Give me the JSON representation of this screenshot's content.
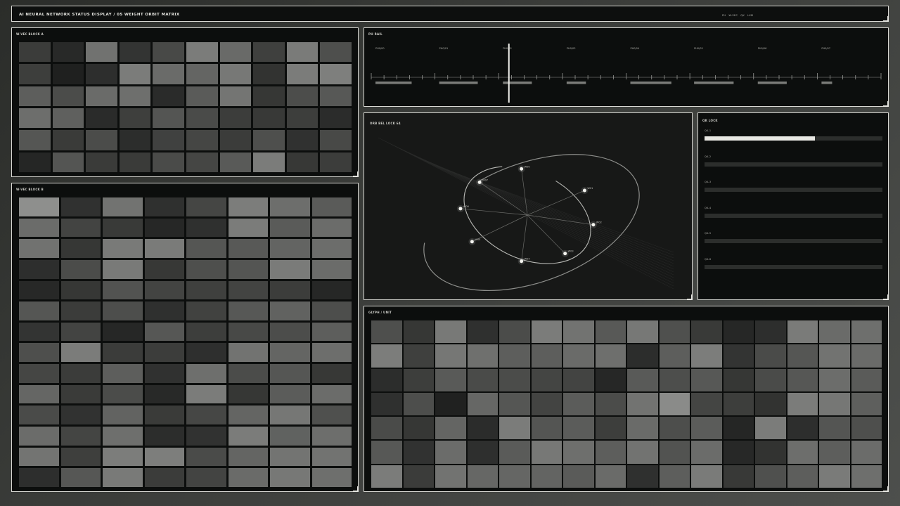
{
  "header": {
    "title": "AI NEURAL NETWORK STATUS DISPLAY  /  05  WEIGHT ORBIT MATRIX",
    "tags": [
      "PH",
      "W-VEC",
      "QK",
      "LUM"
    ]
  },
  "wvec_a": {
    "title": "W-VEC BLOCK A",
    "cols": 10,
    "cells": [
      "#3b3c3a",
      "#282928",
      "#717270",
      "#333433",
      "#484947",
      "#7b7c7a",
      "#696a68",
      "#3f403e",
      "#7a7b79",
      "#4e4f4d",
      "#3d3e3c",
      "#1f201f",
      "#2d2e2d",
      "#7b7c7a",
      "#6a6b69",
      "#646563",
      "#777876",
      "#323331",
      "#7b7c7a",
      "#7e7f7d",
      "#5d5e5c",
      "#4b4c4a",
      "#6a6b69",
      "#6e6f6d",
      "#2a2b2a",
      "#5a5b59",
      "#747573",
      "#363735",
      "#4c4d4b",
      "#575856",
      "#6d6e6c",
      "#5f605e",
      "#2a2b2a",
      "#3e3f3d",
      "#545553",
      "#4a4b49",
      "#3c3d3b",
      "#383937",
      "#3d3e3c",
      "#2b2c2b",
      "#555654",
      "#3a3b39",
      "#4b4c4a",
      "#2c2d2c",
      "#404140",
      "#454644",
      "#3b3c3a",
      "#4e4f4d",
      "#303130",
      "#484947",
      "#252625",
      "#545553",
      "#3a3b39",
      "#3a3b39",
      "#4a4b49",
      "#454644",
      "#595a58",
      "#7b7c7a",
      "#373836",
      "#3c3d3b"
    ]
  },
  "wvec_b": {
    "title": "W-VEC BLOCK B",
    "cols": 8,
    "cells": [
      "#8e8f8d",
      "#303130",
      "#727371",
      "#2f302f",
      "#454644",
      "#7c7d7b",
      "#6d6e6c",
      "#5a5b59",
      "#6b6c6a",
      "#434442",
      "#393a38",
      "#262726",
      "#2f302f",
      "#7b7c7a",
      "#5a5b59",
      "#6b6c6a",
      "#717270",
      "#363735",
      "#797a78",
      "#7a7b79",
      "#555654",
      "#585957",
      "#636462",
      "#6c6d6b",
      "#2d2e2d",
      "#4b4c4a",
      "#797a78",
      "#373836",
      "#4e4f4d",
      "#545553",
      "#7a7b79",
      "#6b6c6a",
      "#272827",
      "#363735",
      "#525351",
      "#434442",
      "#3f403e",
      "#434442",
      "#3c3d3b",
      "#262726",
      "#555654",
      "#3b3c3a",
      "#4d4e4c",
      "#2f302f",
      "#414240",
      "#575856",
      "#616260",
      "#4d4e4c",
      "#333433",
      "#434442",
      "#262726",
      "#565755",
      "#3d3e3c",
      "#484947",
      "#4c4d4b",
      "#5d5e5c",
      "#4e4f4d",
      "#7b7c7a",
      "#3b3c3a",
      "#3c3d3b",
      "#2e2f2e",
      "#727371",
      "#646563",
      "#6d6e6c",
      "#454644",
      "#3b3c3a",
      "#5d5e5c",
      "#303130",
      "#6e6f6d",
      "#4b4c4a",
      "#555654",
      "#373836",
      "#656664",
      "#3a3b39",
      "#4b4c4a",
      "#282928",
      "#7b7c7a",
      "#363735",
      "#5b5c5a",
      "#6b6c6a",
      "#4a4b49",
      "#313231",
      "#626361",
      "#3a3b39",
      "#464745",
      "#646563",
      "#767775",
      "#4f504e",
      "#6b6c6a",
      "#444543",
      "#6e6f6d",
      "#2c2d2c",
      "#313231",
      "#7b7c7a",
      "#606260",
      "#6d6e6c",
      "#737472",
      "#3e3f3d",
      "#7c7d7b",
      "#7d7e7c",
      "#4a4b49",
      "#646563",
      "#737472",
      "#727371",
      "#2d2e2d",
      "#565755",
      "#797a78",
      "#3b3c3a",
      "#434442",
      "#6a6b69",
      "#777876",
      "#6e6f6d"
    ]
  },
  "ph_rail": {
    "title": "PH RAIL",
    "phases": [
      "PH0/00",
      "PH0/01",
      "PH0/02",
      "PH0/03",
      "PH0/04",
      "PH0/05",
      "PH0/06",
      "PH0/07"
    ],
    "levels": [
      0.75,
      0.8,
      0.6,
      0.4,
      0.85,
      0.82,
      0.6,
      0.22
    ],
    "cursor": 0.27
  },
  "orbit": {
    "title": "ORB BEL  LOCK 64",
    "nodes": [
      {
        "label": "W00",
        "angle": 95
      },
      {
        "label": "W01",
        "angle": 32
      },
      {
        "label": "W02",
        "angle": -12
      },
      {
        "label": "W03",
        "angle": -56
      },
      {
        "label": "W04",
        "angle": -95
      },
      {
        "label": "W05",
        "angle": -145
      },
      {
        "label": "W06",
        "angle": 172
      },
      {
        "label": "W07",
        "angle": 135
      }
    ]
  },
  "qk_lock": {
    "title": "QK LOCK",
    "rows": [
      {
        "label": "QK-1",
        "value": 0.62
      },
      {
        "label": "QK-2",
        "value": 0.0
      },
      {
        "label": "QK-3",
        "value": 0.0
      },
      {
        "label": "QK-4",
        "value": 0.0
      },
      {
        "label": "QK-5",
        "value": 0.0
      },
      {
        "label": "QK-6",
        "value": 0.0
      }
    ]
  },
  "glyph": {
    "title": "GLYPH / UNIT",
    "cols": 16,
    "cells": [
      "#4e4f4d",
      "#363735",
      "#787977",
      "#2f302f",
      "#4b4c4a",
      "#7b7c7a",
      "#727371",
      "#585957",
      "#777876",
      "#4f504e",
      "#393a38",
      "#262726",
      "#2d2e2d",
      "#7a7b79",
      "#6a6b69",
      "#6e6f6d",
      "#7c7d7b",
      "#3f403e",
      "#767775",
      "#6f706e",
      "#5d5e5c",
      "#5d5e5c",
      "#6a6b69",
      "#6e6f6d",
      "#2c2d2c",
      "#5d5e5c",
      "#7c7d7b",
      "#333433",
      "#4a4b49",
      "#555654",
      "#727371",
      "#6a6b69",
      "#2c2d2c",
      "#3d3e3c",
      "#595a58",
      "#4a4b49",
      "#4b4c4a",
      "#444543",
      "#434442",
      "#262726",
      "#595a58",
      "#4d4e4c",
      "#575856",
      "#363735",
      "#4a4b49",
      "#565755",
      "#6c6d6b",
      "#5a5b59",
      "#2f302f",
      "#4d4e4c",
      "#202120",
      "#666765",
      "#555654",
      "#434442",
      "#5b5c5a",
      "#4b4c4a",
      "#727371",
      "#8a8b89",
      "#444543",
      "#3d3e3c",
      "#323331",
      "#7b7c7a",
      "#767775",
      "#5e5f5d",
      "#4a4b49",
      "#363735",
      "#646563",
      "#2b2c2b",
      "#7b7c7a",
      "#545553",
      "#5b5c5a",
      "#3d3e3c",
      "#6a6b69",
      "#4d4e4c",
      "#5b5c5a",
      "#252625",
      "#7b7c7a",
      "#2d2e2d",
      "#545553",
      "#4e4f4d",
      "#575856",
      "#313231",
      "#6b6c6a",
      "#2e2f2e",
      "#5a5b59",
      "#777876",
      "#6e6f6d",
      "#5d5e5c",
      "#727371",
      "#525351",
      "#6b6c6a",
      "#272827",
      "#323331",
      "#6d6e6c",
      "#5d5e5c",
      "#6b6c6a",
      "#7b7c7a",
      "#3b3c3a",
      "#727371",
      "#666765",
      "#656664",
      "#636462",
      "#5a5b59",
      "#6a6b69",
      "#2f302f",
      "#5d5e5c",
      "#7a7b79",
      "#383937",
      "#4f504e",
      "#5d5e5c",
      "#7a7b79",
      "#6e6f6d"
    ]
  }
}
